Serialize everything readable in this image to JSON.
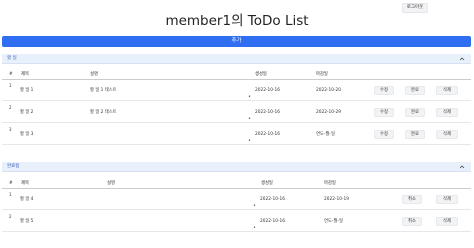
{
  "header": {
    "logout_label": "로그아웃",
    "title": "member1의 ToDo List",
    "add_label": "추가"
  },
  "todo": {
    "title": "할 일",
    "columns": {
      "index": "#",
      "title": "제목",
      "desc": "설명",
      "created": "생성일",
      "due": "마감일"
    },
    "rows": [
      {
        "num": "1",
        "title": "할 일 1",
        "desc": "할 일 1 테스트",
        "created": "2022-10-16",
        "due": "2022-10-20",
        "edit": "수정",
        "done": "완료",
        "delete": "삭제",
        "dot": "•"
      },
      {
        "num": "2",
        "title": "할 일 2",
        "desc": "할 일 2 테스트",
        "created": "2022-10-16",
        "due": "2022-10-29",
        "edit": "수정",
        "done": "완료",
        "delete": "삭제",
        "dot": "•"
      },
      {
        "num": "3",
        "title": "할 일 3",
        "desc": "",
        "created": "2022-10-16",
        "due": "연도-월-일",
        "edit": "수정",
        "done": "완료",
        "delete": "삭제",
        "dot": "•"
      }
    ]
  },
  "completed": {
    "title": "완료됨",
    "columns": {
      "index": "#",
      "title": "제목",
      "desc": "설명",
      "created": "생성일",
      "due": "마감일"
    },
    "rows": [
      {
        "num": "1",
        "title": "할 일 4",
        "desc": "",
        "created": "2022-10-16",
        "due": "2022-10-19",
        "cancel": "취소",
        "delete": "삭제",
        "dot": "•"
      },
      {
        "num": "2",
        "title": "할 일 5",
        "desc": "",
        "created": "2022-10-16",
        "due": "연도-월-일",
        "cancel": "취소",
        "delete": "삭제",
        "dot": "•"
      }
    ]
  },
  "icons": {
    "collapse": "chevron-up-icon"
  },
  "colors": {
    "primary": "#2f6ef0",
    "section_bg": "#e8f0fb",
    "section_text": "#3b5fb3"
  }
}
